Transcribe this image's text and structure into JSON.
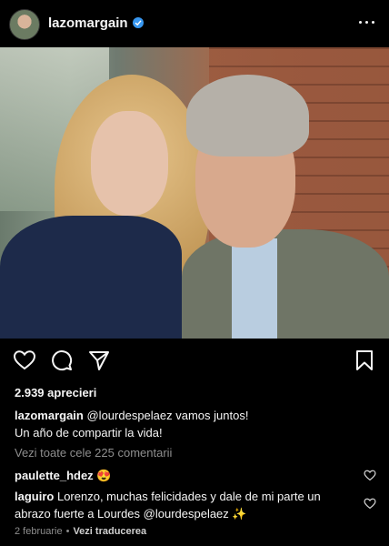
{
  "header": {
    "username": "lazomargain",
    "verified": true,
    "more_icon": "more-horizontal-icon"
  },
  "post": {
    "image_alt_icon": "photo",
    "likes": "2.939 aprecieri",
    "caption": {
      "username": "lazomargain",
      "mention": "@lourdespelaez",
      "text_line1": " vamos juntos!",
      "text_line2": "Un año de compartir la vida!"
    },
    "view_all_comments": "Vezi toate cele 225 comentarii",
    "comments": [
      {
        "username": "paulette_hdez",
        "text": "😍"
      },
      {
        "username": "laguiro",
        "text": "Lorenzo, muchas felicidades y dale de mi parte un abrazo fuerte a Lourdes @lourdespelaez ✨"
      }
    ],
    "date": "2 februarie",
    "separator": "•",
    "translate": "Vezi traducerea"
  },
  "colors": {
    "background": "#000000",
    "text": "#f5f5f5",
    "muted": "#8e8e8e",
    "verified": "#3897f0"
  }
}
